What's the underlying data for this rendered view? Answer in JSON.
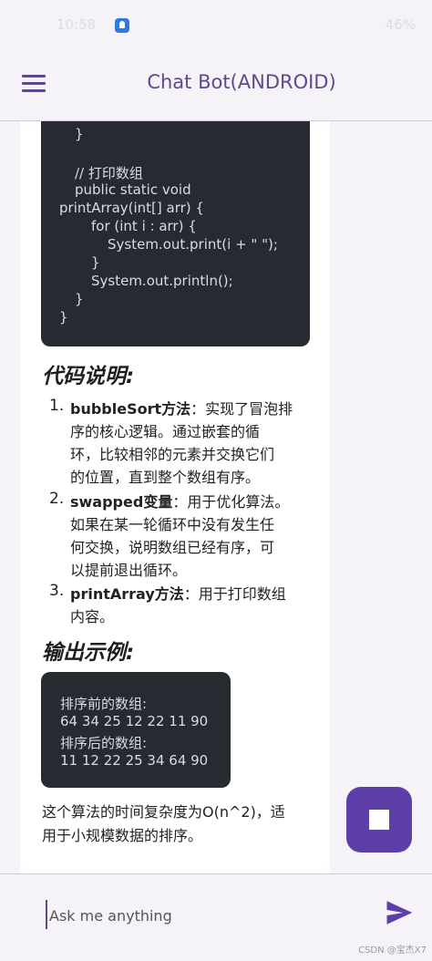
{
  "status_bar": {
    "left": "10:58",
    "right": "46%"
  },
  "app_bar": {
    "title": "Chat Bot(ANDROID)"
  },
  "code": {
    "lines": [
      "}",
      "",
      "// 打印数组",
      "public static void",
      "printArray(int[] arr) {",
      "for (int i : arr) {",
      "System.out.print(i + \" \");",
      "}",
      "System.out.println();",
      "}",
      "}"
    ]
  },
  "explanation": {
    "heading": "代码说明:",
    "items": [
      {
        "num": "1.",
        "lines": [
          "bubbleSort方法：实现了冒泡排",
          "序的核心逻辑。通过嵌套的循",
          "环，比较相邻的元素并交换它们",
          "的位置，直到整个数组有序。"
        ]
      },
      {
        "num": "2.",
        "lines": [
          "swapped变量：用于优化算法。",
          "如果在某一轮循环中没有发生任",
          "何交换，说明数组已经有序，可",
          "以提前退出循环。"
        ]
      },
      {
        "num": "3.",
        "lines": [
          "printArray方法：用于打印数组",
          "内容。"
        ]
      }
    ]
  },
  "output": {
    "heading": "输出示例:",
    "lines": [
      "排序前的数组:",
      "64 34 25 12 22 11 90",
      "排序后的数组:",
      "11 12 22 25 34 64 90"
    ]
  },
  "summary": {
    "lines": [
      "这个算法的时间复杂度为O(n^2)，适",
      "用于小规模数据的排序。"
    ]
  },
  "input": {
    "placeholder": "Ask me anything"
  },
  "watermark": "CSDN @宝杰X7",
  "colors": {
    "accent": "#5d3fa7",
    "title": "#5d4a8c",
    "code_bg": "#272a31"
  },
  "icons": {
    "menu": "hamburger-menu-icon",
    "stop": "stop-icon",
    "send": "send-icon"
  }
}
